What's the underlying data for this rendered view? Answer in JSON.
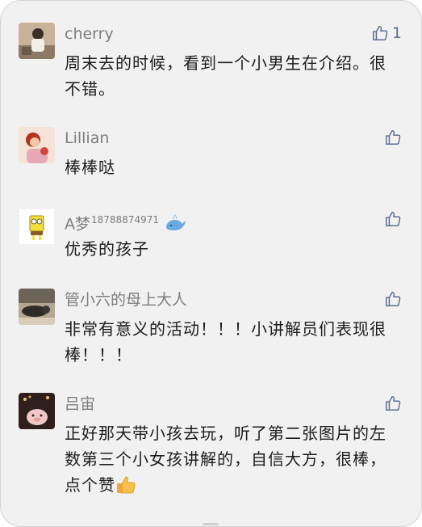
{
  "comments": [
    {
      "name": "cherry",
      "name_sup": "",
      "text": "周末去的时候，看到一个小男生在介绍。很不错。",
      "likes": "1"
    },
    {
      "name": "Lillian",
      "name_sup": "",
      "text": "棒棒哒",
      "likes": ""
    },
    {
      "name": "A梦",
      "name_sup": "18788874971",
      "text": "优秀的孩子",
      "likes": ""
    },
    {
      "name": "管小六的母上大人",
      "name_sup": "",
      "text": "非常有意义的活动！！！小讲解员们表现很棒！！！",
      "likes": ""
    },
    {
      "name": "吕宙",
      "name_sup": "",
      "text": "正好那天带小孩去玩，听了第二张图片的左数第三个小女孩讲解的，自信大方，很棒，点个赞",
      "likes": ""
    }
  ],
  "icons": {
    "like": "thumbs-up-outline-icon",
    "emoji_whale": "whale-emoji-icon",
    "emoji_thumb": "thumbs-up-emoji-icon"
  },
  "colors": {
    "panel_bg": "#f1f1f1",
    "name": "#7d7d7d",
    "text": "#1c1c1c",
    "like": "#5a6e92"
  }
}
